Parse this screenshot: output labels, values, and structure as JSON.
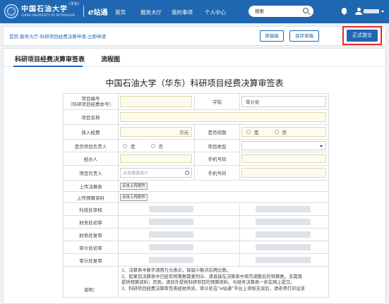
{
  "header": {
    "logo_main": "中国石油大学",
    "logo_tag": "(华东)",
    "logo_sub": "CHINA UNIVERSITY OF PETROLEUM",
    "estation_e": "e",
    "estation_rest": "站通",
    "nav": [
      "首页",
      "服务大厅",
      "我的事项",
      "个人中心"
    ],
    "search_placeholder": "搜索",
    "accent_color": "#1f67b1"
  },
  "breadcrumb": "首页-服务大厅-科研项目经费决算申请-立即申请",
  "toolbar": {
    "draft_box": "草稿箱",
    "save_draft": "保存草稿",
    "submit": "正式提交",
    "highlight_color": "#e8292c"
  },
  "tabs": [
    "科研项目经费决算审签表",
    "流程图"
  ],
  "form": {
    "title": "中国石油大学（华东）科研项目经费决算审签表",
    "project_no_label_1": "项目编号",
    "project_no_label_2": "（科研项目经费本号）",
    "college_label": "学院",
    "college_value": "审计处",
    "project_name_label": "项目名称",
    "funding_label": "拨入经费",
    "funding_unit": "万元",
    "closed_label": "是否结题",
    "yes": "是",
    "no": "否",
    "is_leader_label": "是否项目负责人",
    "project_type_label": "项目类型",
    "handler_label": "经办人",
    "phone_label": "手机号码",
    "leader_label": "项目负责人",
    "leader_placeholder": "点击搜索用户",
    "upload_budget_label": "上传决算表",
    "upload_button": "点击上传附件",
    "upload_extra_label": "上传预算资料",
    "review_rows": [
      "科技处审核",
      "财务处初审",
      "财务处复审",
      "审计处初审",
      "审计处复审"
    ],
    "notes_label": "说明：",
    "notes": [
      "1、决算表中数字请用万元表示，保留小数点后两位数。",
      "2、如果到决算表中已经有预算数需要列示，请直接在决算表中填写调整后的预算数，无需再",
      "提供预算资料；否则，请另外提供科研项目的预算资料，与财务决算表一并在网上提交。",
      "3、科研项目经费决算审签表经财务处、审计处在“e站通”平台上审核无误后，请老师打印出该"
    ]
  }
}
